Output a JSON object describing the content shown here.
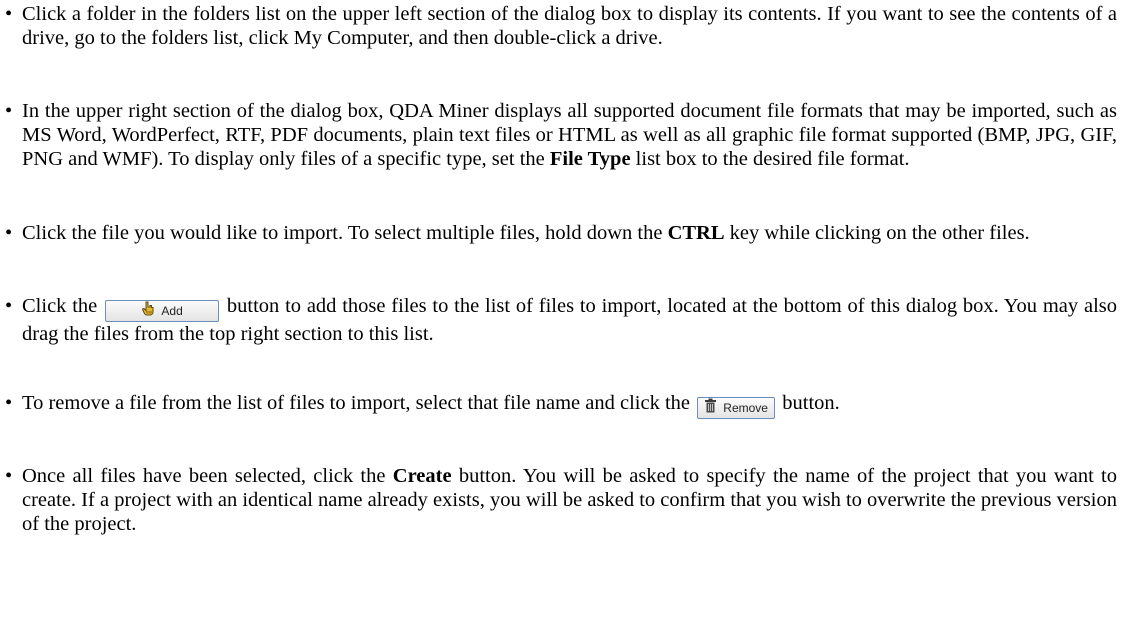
{
  "bullet": "•",
  "p1": {
    "text": "Click a folder in the folders list on the upper left section of the dialog box to display its contents. If you want to see the contents of a drive, go to the folders list, click My Computer, and then double-click a drive."
  },
  "p2": {
    "text_before": "In the upper right section of the dialog box, QDA Miner displays all supported document file formats that may be imported, such as MS Word, WordPerfect, RTF, PDF documents, plain text files or HTML as well as all graphic file format supported (BMP, JPG, GIF, PNG and WMF). To display only files of a specific type, set the ",
    "bold": "File Type",
    "text_after": " list box to the desired file format."
  },
  "p3": {
    "text_before": "Click the file you would like to import. To select multiple files, hold down the ",
    "bold": "CTRL",
    "text_after": " key while clicking on the other files."
  },
  "p4": {
    "text_before": "Click the ",
    "button_label": "Add",
    "button_icon": "hand-pointer-icon",
    "text_after": " button to add those files to the list of files to import, located at the bottom of this dialog box. You may also drag the files from the top right section to this list."
  },
  "p5": {
    "text_before": "To remove a file from the list of files to import, select that file name and click the ",
    "button_label": "Remove",
    "button_icon": "trash-can-icon",
    "text_after": " button."
  },
  "p6": {
    "text_before": "Once all files have been selected, click the ",
    "bold": "Create",
    "text_after": " button. You will be asked to specify the name of the project that you want to create. If a project with an identical name already exists, you will be asked to confirm that you wish to overwrite the previous version of the project."
  }
}
